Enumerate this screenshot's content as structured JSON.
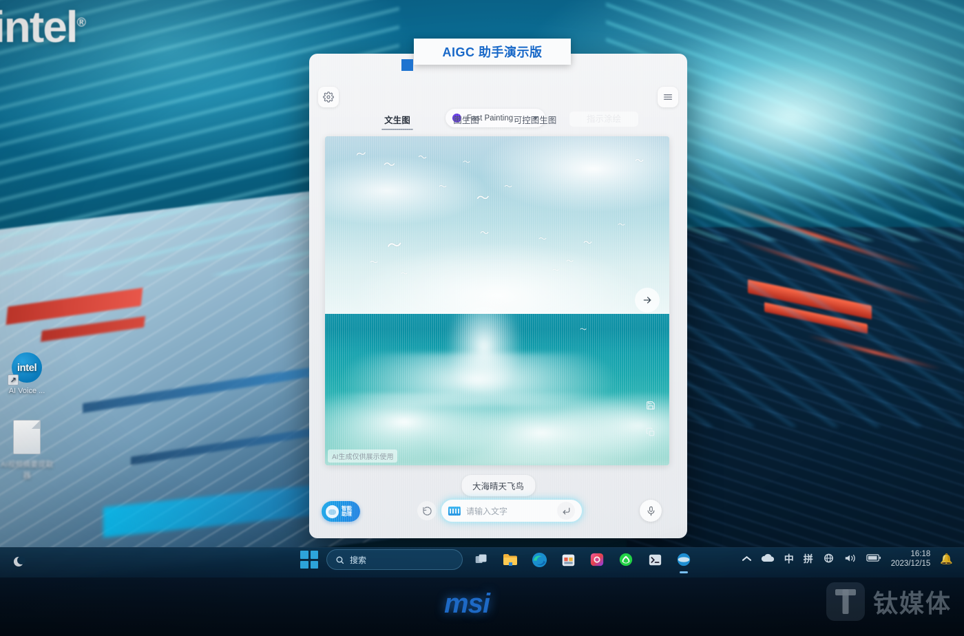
{
  "desktop": {
    "brand_logo": "intel",
    "brand_mark": "®",
    "icons": [
      {
        "label": "AI Voice ...",
        "icon": "intel-shortcut-icon",
        "glyph": "intel"
      },
      {
        "label": "AI视频摘要提取器",
        "icon": "document-icon",
        "glyph": ""
      }
    ]
  },
  "taskbar": {
    "start_label": "Start",
    "search_placeholder": "搜索",
    "items": [
      {
        "name": "task-view",
        "label": "任务视图"
      },
      {
        "name": "file-explorer",
        "label": "文件资源管理器"
      },
      {
        "name": "edge-browser",
        "label": "Microsoft Edge"
      },
      {
        "name": "microsoft-store",
        "label": "Microsoft Store"
      },
      {
        "name": "photos",
        "label": "照片"
      },
      {
        "name": "xbox",
        "label": "Xbox"
      },
      {
        "name": "terminal",
        "label": "终端"
      },
      {
        "name": "aigc-app",
        "label": "AIGC 助手"
      }
    ],
    "tray": {
      "overflow": "显示隐藏的图标",
      "cloud": "OneDrive",
      "ime_mode": "中",
      "ime_pinyin": "拼",
      "network": "网络",
      "volume": "音量",
      "battery": "电池",
      "time": "16:18",
      "date": "2023/12/15",
      "notifications": "通知"
    }
  },
  "hardware": {
    "laptop_brand": "msi",
    "watermark": "钛媒体"
  },
  "app": {
    "title": "AIGC 助手演示版",
    "settings_icon": "gear-icon",
    "menu_icon": "hamburger-menu-icon",
    "model": {
      "name": "Fast Painting",
      "dot_color": "#6036e0",
      "caret_icon": "chevron-down-icon"
    },
    "tabs": [
      {
        "label": "文生图",
        "active": true
      },
      {
        "label": "图生图",
        "active": false
      },
      {
        "label": "可控图生图",
        "active": false
      },
      {
        "label": "指示涂绘",
        "active": false,
        "ghost": true
      }
    ],
    "canvas": {
      "watermark": "AI生成仅供展示使用",
      "next_icon": "arrow-right-icon",
      "save_icon": "save-icon",
      "copy_icon": "copy-icon",
      "alt": "大海晴天飞鸟 —— 海浪与海鸥"
    },
    "prompt_chip": "大海晴天飞鸟",
    "assistant_badge": {
      "line1": "智能",
      "line2": "助理"
    },
    "refresh_icon": "refresh-icon",
    "input": {
      "placeholder": "请输入文字",
      "value": "",
      "keyboard_icon": "keyboard-icon",
      "enter_icon": "enter-arrow-icon"
    },
    "mic_icon": "microphone-icon"
  },
  "colors": {
    "accent_blue": "#1868c8",
    "model_purple": "#6036e0",
    "taskbar": "#0e3450",
    "input_glow": "#b9e6f2"
  }
}
